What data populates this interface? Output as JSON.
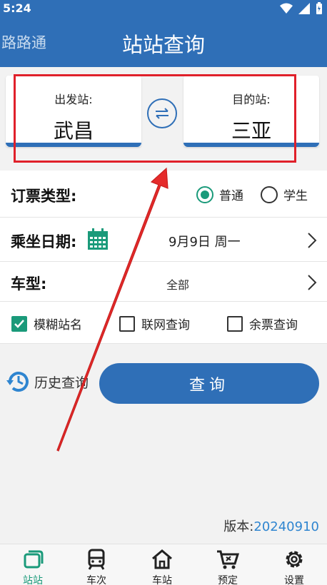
{
  "status_bar": {
    "time": "5:24"
  },
  "app_bar": {
    "app_name": "路路通",
    "title": "站站查询"
  },
  "stations": {
    "from_label": "出发站:",
    "from_value": "武昌",
    "to_label": "目的站:",
    "to_value": "三亚",
    "swap_icon": "swap-arrows-icon"
  },
  "form": {
    "ticket_type_label": "订票类型:",
    "ticket_options": [
      {
        "label": "普通",
        "checked": true
      },
      {
        "label": "学生",
        "checked": false
      }
    ],
    "date_label": "乘坐日期:",
    "date_value": "9月9日 周一",
    "train_type_label": "车型:",
    "train_type_value": "全部",
    "options": [
      {
        "label": "模糊站名",
        "checked": true
      },
      {
        "label": "联网查询",
        "checked": false
      },
      {
        "label": "余票查询",
        "checked": false
      }
    ]
  },
  "actions": {
    "history_label": "历史查询",
    "query_label": "查询"
  },
  "version": {
    "label": "版本:",
    "number": "20240910"
  },
  "bottom_nav": [
    {
      "label": "站站",
      "icon": "stack-icon",
      "active": true
    },
    {
      "label": "车次",
      "icon": "train-icon",
      "active": false
    },
    {
      "label": "车站",
      "icon": "home-icon",
      "active": false
    },
    {
      "label": "预定",
      "icon": "cart-icon",
      "active": false
    },
    {
      "label": "设置",
      "icon": "gear-icon",
      "active": false
    }
  ],
  "colors": {
    "primary": "#2f6fb7",
    "accent_green": "#1a9a7a",
    "annotation_red": "#e0202a",
    "version_blue": "#2f85d0"
  }
}
